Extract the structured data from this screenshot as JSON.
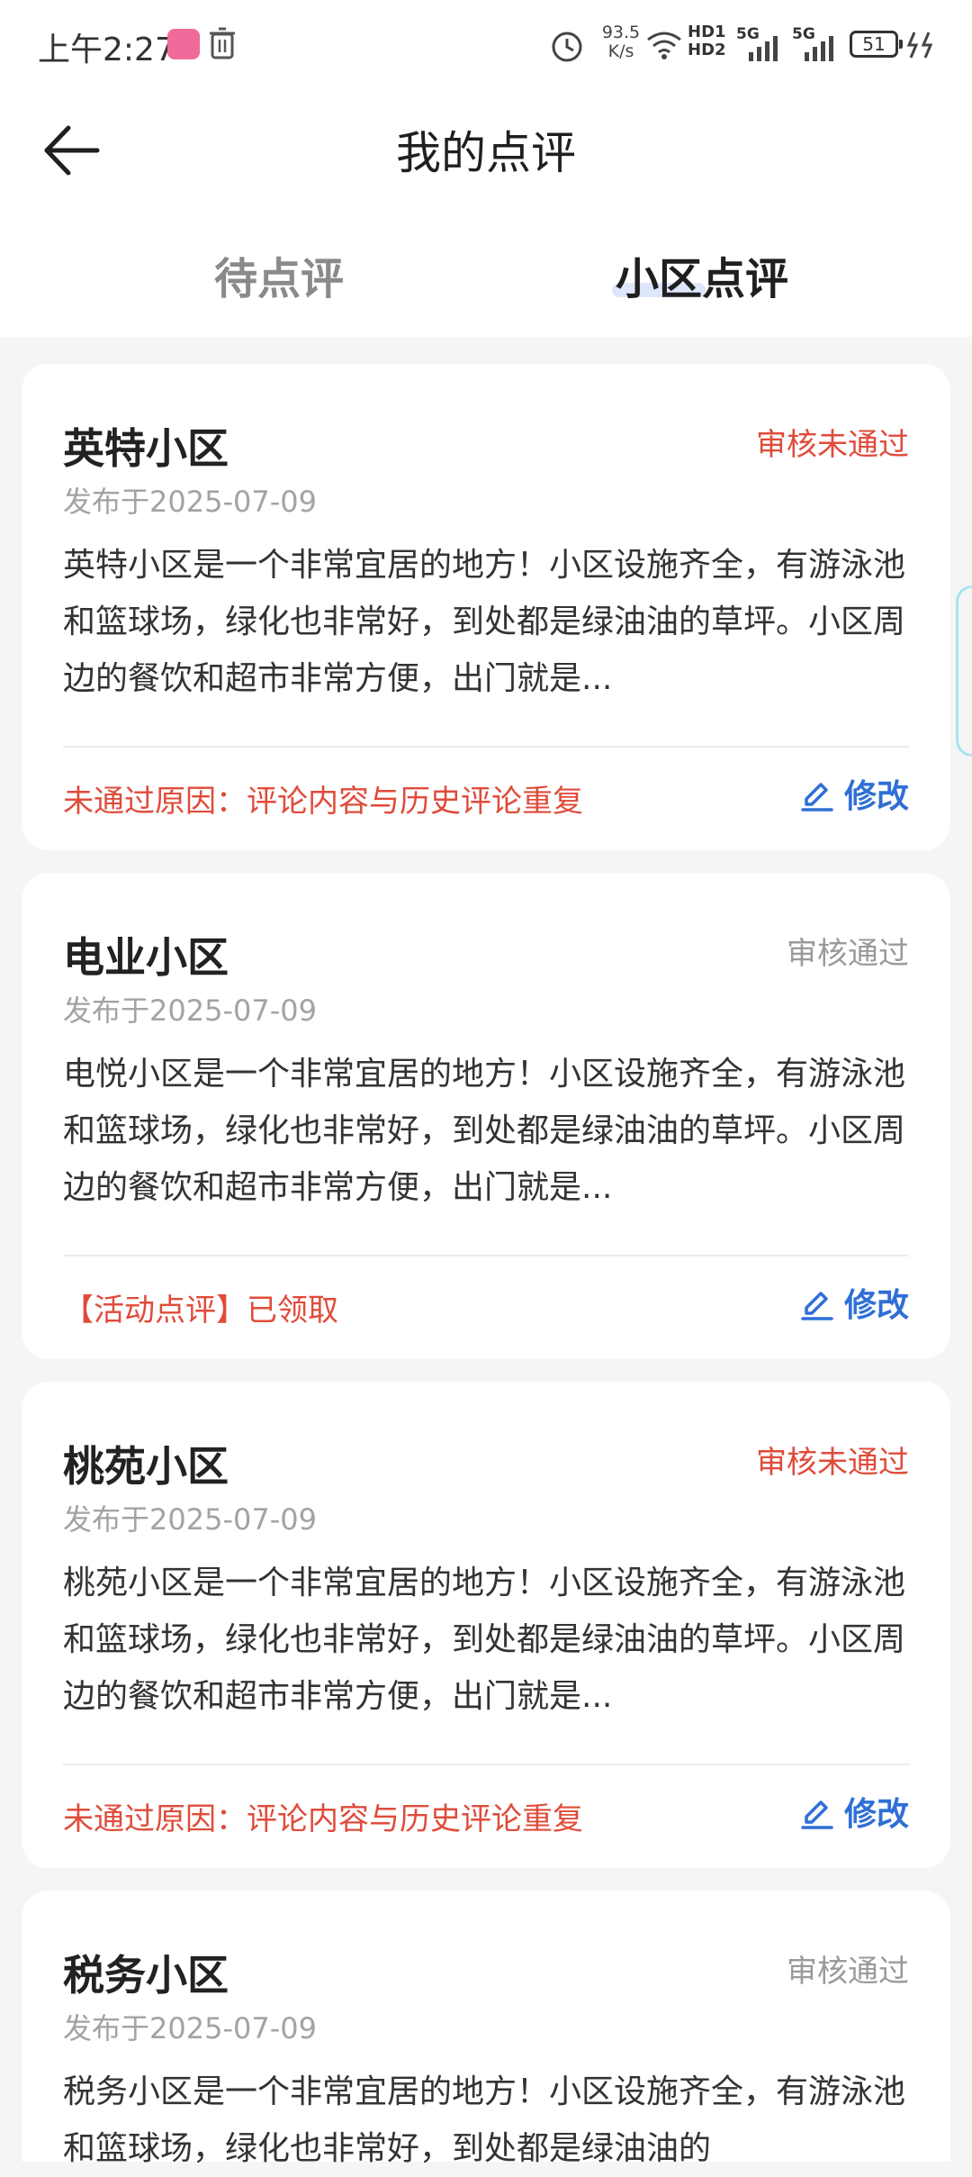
{
  "status_bar": {
    "time": "上午2:27",
    "net_speed_value": "93.5",
    "net_speed_unit": "K/s",
    "hd1": "HD1",
    "hd2": "HD2",
    "signal1": "5G",
    "signal2": "5G",
    "battery": "51"
  },
  "header": {
    "title": "我的点评"
  },
  "tabs": [
    {
      "label": "待点评",
      "active": false
    },
    {
      "label": "小区点评",
      "active": true
    }
  ],
  "edit_label": "修改",
  "reviews": [
    {
      "name": "英特小区",
      "status": "审核未通过",
      "date": "发布于2025-07-09",
      "content": "英特小区是一个非常宜居的地方！小区设施齐全，有游泳池和篮球场，绿化也非常好，到处都是绿油油的草坪。小区周边的餐饮和超市非常方便，出门就是...",
      "note": "未通过原因：评论内容与历史评论重复"
    },
    {
      "name": "电业小区",
      "status": "审核通过",
      "date": "发布于2025-07-09",
      "content": "电悦小区是一个非常宜居的地方！小区设施齐全，有游泳池和篮球场，绿化也非常好，到处都是绿油油的草坪。小区周边的餐饮和超市非常方便，出门就是...",
      "note": "【活动点评】已领取"
    },
    {
      "name": "桃苑小区",
      "status": "审核未通过",
      "date": "发布于2025-07-09",
      "content": "桃苑小区是一个非常宜居的地方！小区设施齐全，有游泳池和篮球场，绿化也非常好，到处都是绿油油的草坪。小区周边的餐饮和超市非常方便，出门就是...",
      "note": "未通过原因：评论内容与历史评论重复"
    },
    {
      "name": "税务小区",
      "status": "审核通过",
      "date": "发布于2025-07-09",
      "content": "税务小区是一个非常宜居的地方！小区设施齐全，有游泳池和篮球场，绿化也非常好，到处都是绿油油的"
    }
  ],
  "colors": {
    "fail": "#e04b3a",
    "pass": "#9a9a9a",
    "accent": "#2f6fd6"
  }
}
